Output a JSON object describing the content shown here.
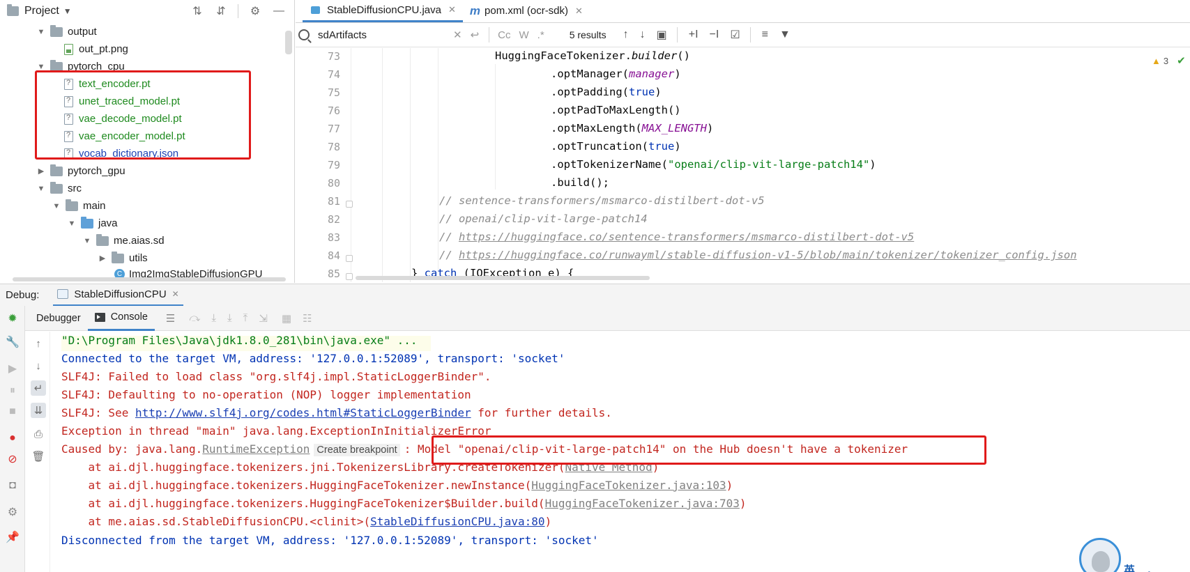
{
  "project_panel": {
    "title": "Project",
    "tree": [
      {
        "label": "output",
        "type": "folder",
        "expanded": true
      },
      {
        "label": "out_pt.png",
        "type": "file-image"
      },
      {
        "label": "pytorch_cpu",
        "type": "folder",
        "expanded": true
      },
      {
        "label": "text_encoder.pt",
        "type": "file-unknown",
        "color": "#1e8a1e"
      },
      {
        "label": "unet_traced_model.pt",
        "type": "file-unknown",
        "color": "#1e8a1e"
      },
      {
        "label": "vae_decode_model.pt",
        "type": "file-unknown",
        "color": "#1e8a1e"
      },
      {
        "label": "vae_encoder_model.pt",
        "type": "file-unknown",
        "color": "#1e8a1e"
      },
      {
        "label": "vocab_dictionary.json",
        "type": "file-json",
        "color": "#1a3fb3"
      },
      {
        "label": "pytorch_gpu",
        "type": "folder",
        "expanded": false
      },
      {
        "label": "src",
        "type": "folder",
        "expanded": true
      },
      {
        "label": "main",
        "type": "folder",
        "expanded": true
      },
      {
        "label": "java",
        "type": "folder-source",
        "expanded": true
      },
      {
        "label": "me.aias.sd",
        "type": "package",
        "expanded": true
      },
      {
        "label": "utils",
        "type": "package",
        "expanded": false
      },
      {
        "label": "Img2ImgStableDiffusionGPU",
        "type": "class"
      }
    ]
  },
  "editor": {
    "tabs": [
      {
        "label": "StableDiffusionCPU.java",
        "active": true,
        "icon": "java-class-icon"
      },
      {
        "label": "pom.xml (ocr-sdk)",
        "active": false,
        "icon": "maven-icon"
      }
    ],
    "search": {
      "query": "sdArtifacts",
      "results": "5 results",
      "option_case": "Cc",
      "option_words": "W",
      "option_regex": ".*"
    },
    "inspection_badge": "3",
    "code_lines": [
      {
        "num": "73",
        "text": "HuggingFaceTokenizer."
      },
      {
        "num": "74",
        "text": ".optManager("
      },
      {
        "num": "75",
        "text": ".optPadding("
      },
      {
        "num": "76",
        "text": ".optPadToMaxLength()"
      },
      {
        "num": "77",
        "text": ".optMaxLength("
      },
      {
        "num": "78",
        "text": ".optTruncation("
      },
      {
        "num": "79",
        "text": ".optTokenizerName("
      },
      {
        "num": "80",
        "text": ".build();"
      },
      {
        "num": "81",
        "text": "// sentence-transformers/msmarco-distilbert-dot-v5"
      },
      {
        "num": "82",
        "text": "// openai/clip-vit-large-patch14"
      },
      {
        "num": "83",
        "text": "https://huggingface.co/sentence-transformers/msmarco-distilbert-dot-v5"
      },
      {
        "num": "84",
        "text": "https://huggingface.co/runwayml/stable-diffusion-v1-5/blob/main/tokenizer/tokenizer_config.json"
      },
      {
        "num": "85",
        "text": "} "
      }
    ],
    "tokens": {
      "builder": "builder",
      "builder_tail": "()",
      "manager": "manager",
      "close_paren": ")",
      "true_kw": "true",
      "max_length": "MAX_LENGTH",
      "tokenizer_name": "\"openai/clip-vit-large-patch14\"",
      "comment_prefix": "// ",
      "catch_kw": "catch",
      "catch_tail": " (IOException e) {"
    }
  },
  "debug": {
    "label": "Debug:",
    "tab": "StableDiffusionCPU",
    "subtabs": [
      "Debugger",
      "Console"
    ],
    "console": {
      "line1": "\"D:\\Program Files\\Java\\jdk1.8.0_281\\bin\\java.exe\" ...",
      "line2": "Connected to the target VM, address: '127.0.0.1:52089', transport: 'socket'",
      "line3": "SLF4J: Failed to load class \"org.slf4j.impl.StaticLoggerBinder\".",
      "line4": "SLF4J: Defaulting to no-operation (NOP) logger implementation",
      "line5_prefix": "SLF4J: See ",
      "line5_link": "http://www.slf4j.org/codes.html#StaticLoggerBinder",
      "line5_suffix": " for further details.",
      "line6": "Exception in thread \"main\" java.lang.ExceptionInInitializerError",
      "line7_prefix": "Caused by: java.lang.",
      "line7_exception": "RuntimeException",
      "line7_breakpoint": "Create breakpoint",
      "line7_message": ": Model \"openai/clip-vit-large-patch14\" on the Hub doesn't have a tokenizer",
      "line8_prefix": "    at ai.djl.huggingface.tokenizers.jni.TokenizersLibrary.createTokenizer(",
      "line8_link": "Native Method",
      "line8_suffix": ")",
      "line9_prefix": "    at ai.djl.huggingface.tokenizers.HuggingFaceTokenizer.newInstance(",
      "line9_link": "HuggingFaceTokenizer.java:103",
      "line9_suffix": ")",
      "line10_prefix": "    at ai.djl.huggingface.tokenizers.HuggingFaceTokenizer$Builder.build(",
      "line10_link": "HuggingFaceTokenizer.java:703",
      "line10_suffix": ")",
      "line11_prefix": "    at me.aias.sd.StableDiffusionCPU.<clinit>(",
      "line11_link": "StableDiffusionCPU.java:80",
      "line11_suffix": ")",
      "line12": "Disconnected from the target VM, address: '127.0.0.1:52089', transport: 'socket'"
    }
  },
  "ime": {
    "text": "英 ，"
  },
  "colors": {
    "accent": "#4083c9",
    "highlight_box": "#e01a1a",
    "error_text": "#c2261f",
    "info_text": "#0033b3"
  }
}
